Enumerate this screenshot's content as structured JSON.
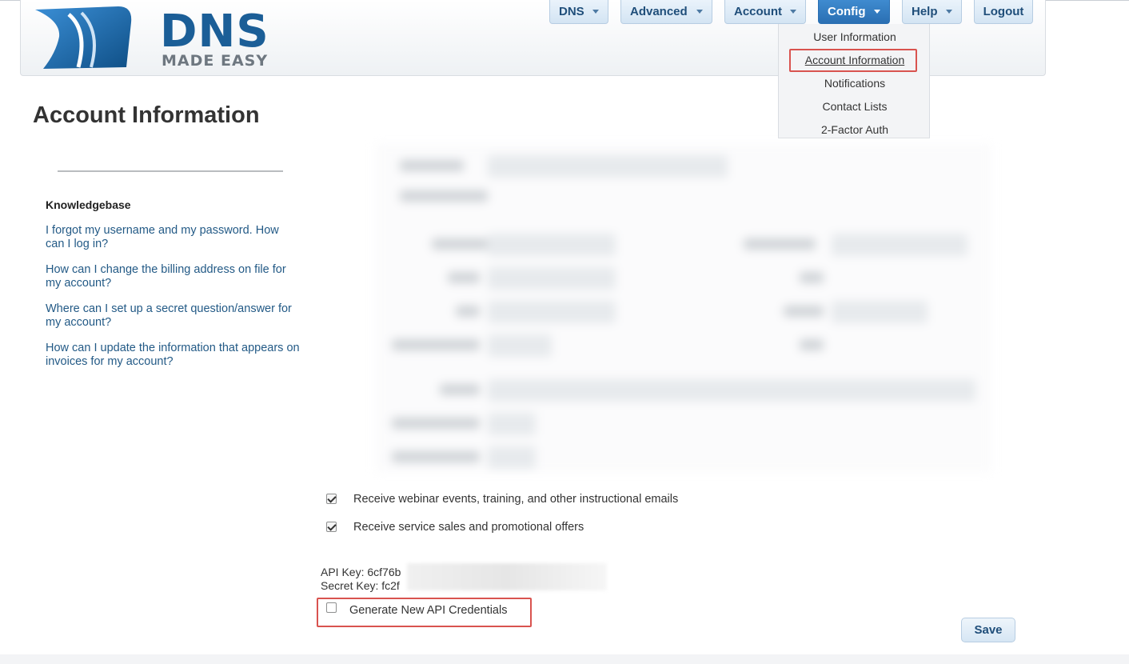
{
  "brand": {
    "name": "DNS",
    "tagline": "MADE EASY"
  },
  "nav": {
    "items": [
      {
        "label": "DNS"
      },
      {
        "label": "Advanced"
      },
      {
        "label": "Account"
      },
      {
        "label": "Config"
      },
      {
        "label": "Help"
      }
    ],
    "logout_label": "Logout"
  },
  "config_menu": {
    "items": [
      {
        "label": "User Information"
      },
      {
        "label": "Account Information"
      },
      {
        "label": "Notifications"
      },
      {
        "label": "Contact Lists"
      },
      {
        "label": "2-Factor Auth"
      }
    ]
  },
  "page": {
    "title": "Account Information"
  },
  "sidebar": {
    "heading": "Knowledgebase",
    "links": [
      {
        "label": "I forgot my username and my password. How can I log in?"
      },
      {
        "label": "How can I change the billing address on file for my account?"
      },
      {
        "label": "Where can I set up a secret question/answer for my account?"
      },
      {
        "label": "How can I update the information that appears on invoices for my account?"
      }
    ]
  },
  "preferences": {
    "webinar_label": "Receive webinar events, training, and other instructional emails",
    "webinar_checked": true,
    "sales_label": "Receive service sales and promotional offers",
    "sales_checked": true
  },
  "api": {
    "api_key_label": "API Key: 6cf76b",
    "secret_key_label": "Secret Key: fc2f",
    "generate_label": "Generate New API Credentials",
    "generate_checked": false
  },
  "actions": {
    "save_label": "Save"
  },
  "colors": {
    "accent": "#2a6fb3",
    "highlight": "#d9534f",
    "link": "#235a86"
  }
}
